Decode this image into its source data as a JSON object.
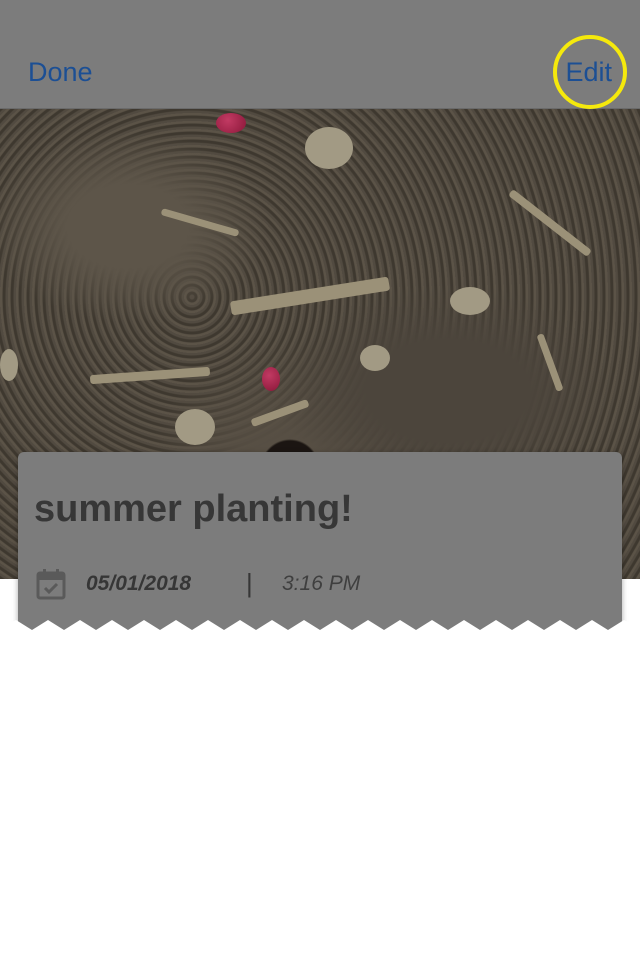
{
  "navbar": {
    "done_label": "Done",
    "edit_label": "Edit"
  },
  "entry": {
    "title": "summer planting!",
    "date": "05/01/2018",
    "separator": "|",
    "time": "3:16 PM",
    "icon": "calendar-check-icon"
  },
  "colors": {
    "nav_link": "#1c4f94",
    "highlight": "#f5e90c",
    "overlay_gray": "#7c7c7c"
  }
}
